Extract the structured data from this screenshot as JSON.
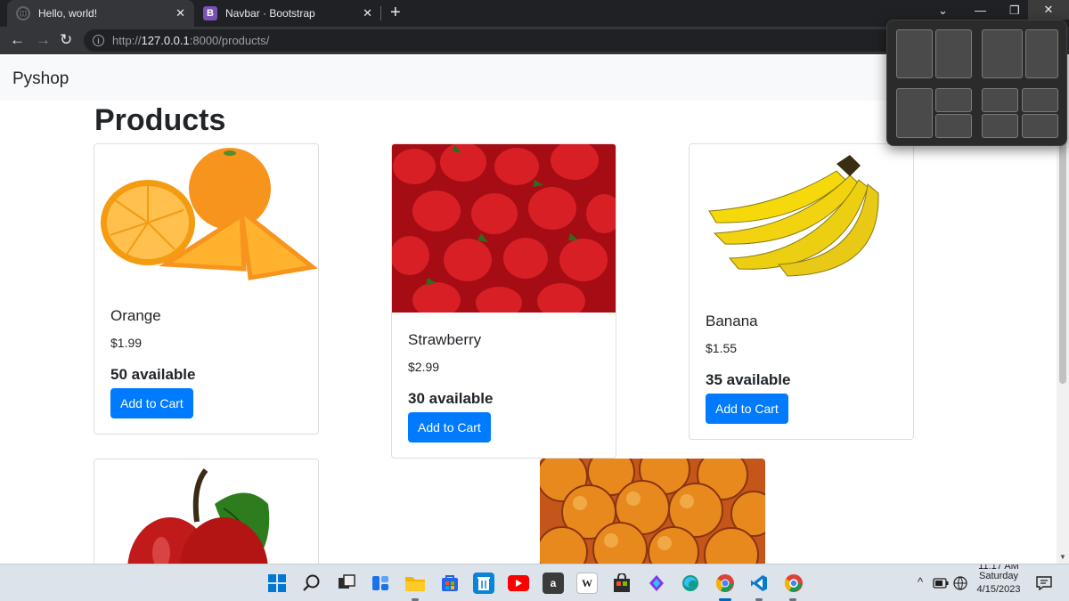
{
  "browser": {
    "tabs": [
      {
        "title": "Hello, world!",
        "active": true,
        "favicon": "globe-icon"
      },
      {
        "title": "Navbar · Bootstrap",
        "active": false,
        "favicon": "bootstrap-logo",
        "favicon_letter": "B"
      }
    ],
    "url": {
      "scheme": "http://",
      "host": "127.0.0.1",
      "path": ":8000/products/"
    }
  },
  "page": {
    "brand": "Pyshop",
    "title": "Products",
    "colors": {
      "primary_button": "#007bff",
      "navbar_bg": "#f8f9fa"
    },
    "products": [
      {
        "name": "Orange",
        "price": "$1.99",
        "stock": "50 available",
        "button": "Add to Cart"
      },
      {
        "name": "Strawberry",
        "price": "$2.99",
        "stock": "30 available",
        "button": "Add to Cart"
      },
      {
        "name": "Banana",
        "price": "$1.55",
        "stock": "35 available",
        "button": "Add to Cart"
      }
    ]
  },
  "taskbar": {
    "clock_time": "11:17 AM",
    "clock_day": "Saturday",
    "clock_date": "4/15/2023",
    "amazon_letter": "a",
    "wikipedia_letter": "W"
  }
}
